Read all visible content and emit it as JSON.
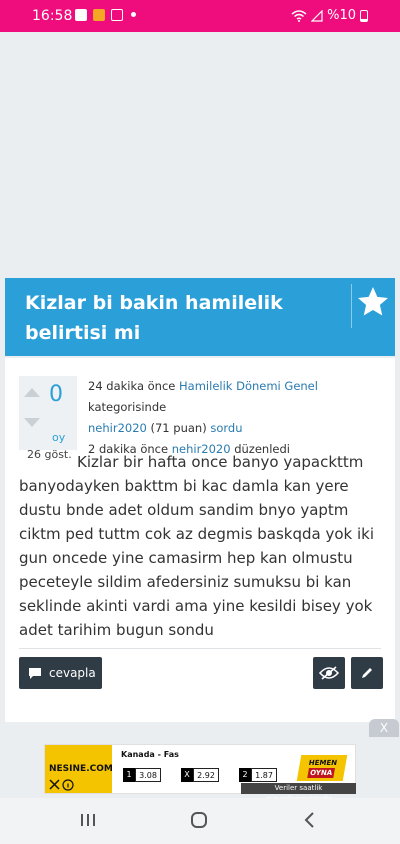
{
  "status_bar": {
    "time": "16:58",
    "battery": "%10"
  },
  "question": {
    "title": "Kizlar bi bakin hamilelik belirtisi mi",
    "votes": "0",
    "votes_label": "oy",
    "views": "26 göst.",
    "meta": {
      "asked_time": "24 dakika önce",
      "category": "Hamilelik Dönemi Genel",
      "category_suffix": "kategorisinde",
      "author": "nehir2020",
      "points": "(71 puan)",
      "asked_label": "sordu",
      "edited_time": "2 dakika önce",
      "editor": "nehir2020",
      "edited_label": "düzenledi"
    },
    "body": "Kizlar bir hafta once banyo yapackttm banyodayken bakttm bi kac damla kan yere dustu bnde adet oldum sandim bnyo yaptm ciktm ped tuttm cok az degmis baskqda yok iki gun oncede yine camasirm hep kan olmustu peceteyle sildim afedersiniz sumuksu bi kan seklinde akinti vardi ama yine kesildi bisey yok adet tarihim bugun sondu",
    "reply_label": "cevapla"
  },
  "ad": {
    "close_label": "X",
    "brand": "NESINE.COM",
    "match": "Kanada - Fas",
    "odds": [
      {
        "key": "1",
        "value": "3.08"
      },
      {
        "key": "X",
        "value": "2.92"
      },
      {
        "key": "2",
        "value": "1.87"
      }
    ],
    "cta_top": "HEMEN",
    "cta_bottom": "OYNA",
    "footnote": "Veriler saatlik güncellenmektedir"
  },
  "colors": {
    "status_bar": "#ef0d7e",
    "title_bar": "#2a9fd8",
    "button": "#2f3b45",
    "link": "#2a7bb0"
  }
}
